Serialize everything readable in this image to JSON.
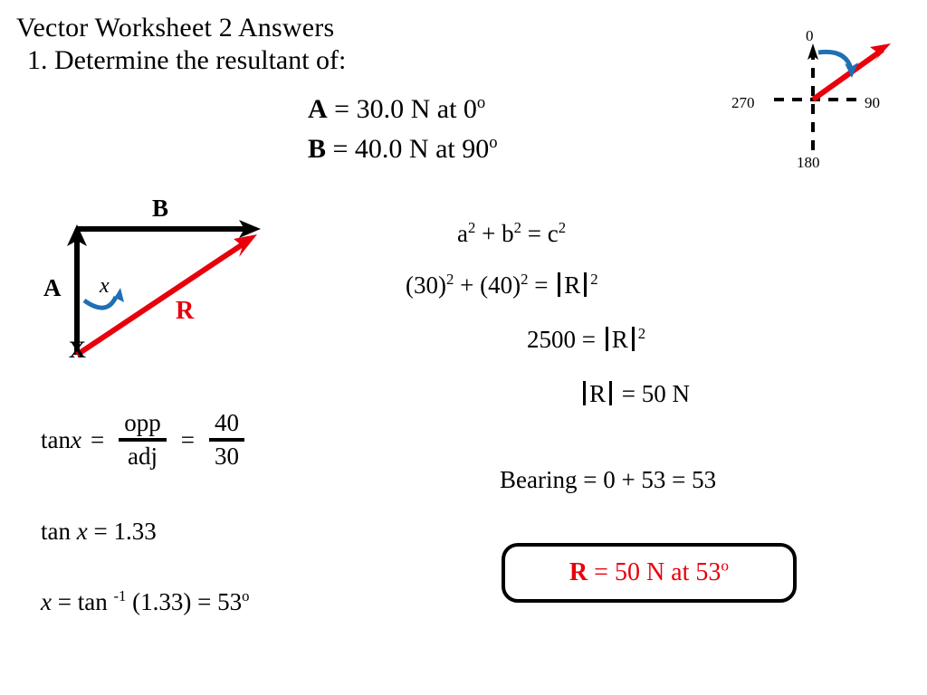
{
  "title": "Vector Worksheet 2 Answers",
  "prompt": "1. Determine the resultant of:",
  "given": {
    "a_label": "A",
    "a_value": " = 30.0 N at 0",
    "a_deg": "o",
    "b_label": "B",
    "b_value": " = 40.0 N at 90",
    "b_deg": "o"
  },
  "compass": {
    "north": "0",
    "east": "90",
    "south": "180",
    "west": "270"
  },
  "triangle": {
    "label_a": "A",
    "label_b": "B",
    "label_r": "R",
    "label_angle": "x",
    "label_origin": "X"
  },
  "math": {
    "pythagorean": {
      "a": "a",
      "a_sup": "2",
      "plus": " + ",
      "b": "b",
      "b_sup": "2",
      "equals": " = ",
      "c": "c",
      "c_sup": "2"
    },
    "substitution": {
      "lhs_a": "(30)",
      "lhs_a_sup": "2",
      "plus": " + ",
      "lhs_b": "(40)",
      "lhs_b_sup": "2",
      "equals": " = ",
      "r": "R",
      "r_sup": "2"
    },
    "squared_value": {
      "value": "2500",
      "equals": " = ",
      "r": "R",
      "r_sup": "2"
    },
    "magnitude": {
      "r": "R",
      "equals": " = ",
      "value": "50 N"
    },
    "tangent_fraction": {
      "lead": "tan ",
      "var": "x",
      "equals1": "=",
      "num1": "opp",
      "den1": "adj",
      "equals2": "=",
      "num2": "40",
      "den2": "30"
    },
    "tangent_value": {
      "lead": "tan ",
      "var": "x",
      "rest": "  =  1.33"
    },
    "inverse_tangent": {
      "var": "x",
      "mid": "  =  tan ",
      "exp": "-1",
      "rest": " (1.33)  =  53",
      "deg": "o"
    },
    "bearing": "Bearing  =  0  +  53  =  53"
  },
  "answer": {
    "r": "R",
    "rest": "  =  50 N at 53",
    "deg": "o"
  },
  "colors": {
    "red": "#E8000B",
    "blue": "#1F6FB5",
    "black": "#000000"
  }
}
